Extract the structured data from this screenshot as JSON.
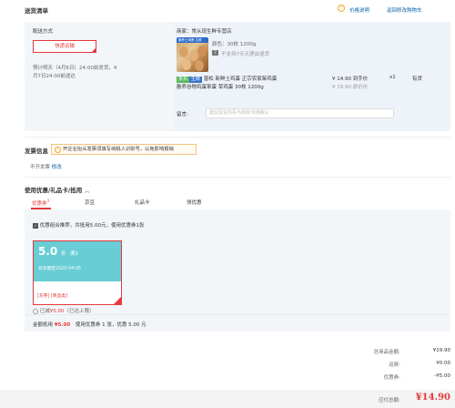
{
  "shipping": {
    "title": "送货清单",
    "price_info_label": "价格说明",
    "back_to_cart_label": "返回修改购物车",
    "method_title": "配送方式",
    "method_value": "快递运输",
    "estimate_line1": "预计明天（4月6日）24:00前发货，4",
    "estimate_line2": "月7日24:00前送达",
    "seller_label": "商家：常从现生鲜专营店",
    "spec_label": "颜色：30枚 1200g",
    "no_return_label": "不支持7天无理由退货",
    "product_line1": "晋松 新鲜土鸡蛋 正宗农家柴鸡蛋",
    "product_line2": "散养谷物鸡蛋笨蛋 草鸡蛋 30枚 1200g",
    "tag_green": "京东",
    "tag_blue": "生鲜",
    "price": "¥ 14.90 到手价",
    "original_price": "¥ 19.90 原价价",
    "qty": "x1",
    "stock": "有货",
    "message_label": "留言:",
    "message_placeholder": "建议留言前先与商家沟通确认",
    "thumb_label": "散养土鸡蛋 生鲜"
  },
  "invoice": {
    "title": "发票信息",
    "tip": "开企业抬头发票须填写纳税人识别号，以免影响报销",
    "status": "不开发票",
    "modify_label": "修改"
  },
  "coupons": {
    "title": "使用优惠/礼品卡/抵用",
    "tabs": [
      "优惠券",
      "京豆",
      "礼品卡",
      "领优惠"
    ],
    "tab_badge": "3",
    "combo_label": "优惠组合推荐，共抵用5.00元，使用优惠券1张",
    "card_amount": "5.0",
    "card_unit": "折",
    "card_condition": "满1",
    "card_valid": "有效期至2025-04-05",
    "card_scope1": "[东券]",
    "card_scope2": "[商品类]",
    "deduct_label": "已减",
    "deduct_amount": "¥5.00",
    "deduct_note": "（已达上限）",
    "summary_prefix": "金额抵用",
    "summary_amount": "¥5.00",
    "summary_text": "使用优惠券 1 张，优惠 5.00 元"
  },
  "totals": {
    "goods_label": "总商品金额:",
    "goods_value": "¥19.90",
    "freight_label": "运费:",
    "freight_value": "¥0.00",
    "discount_label": "优惠券:",
    "discount_value": "-¥5.00",
    "pay_label": "应付总额:",
    "pay_value": "¥14.90"
  },
  "colors": {
    "accent": "#e4393c",
    "link": "#005ea7",
    "coupon": "#68cdd5"
  }
}
